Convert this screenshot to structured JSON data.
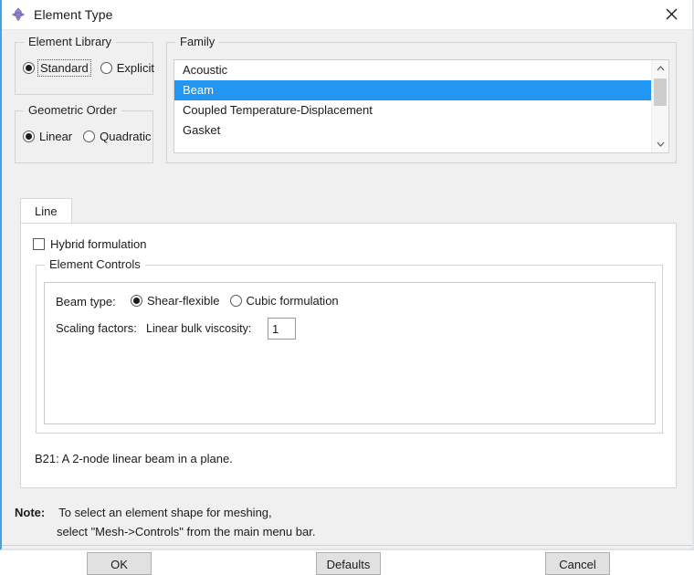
{
  "window": {
    "title": "Element Type",
    "icon": "abaqus-element-icon",
    "close_icon": "close-icon",
    "accent_color": "#4a9fe0"
  },
  "element_library": {
    "group_title": "Element Library",
    "options": [
      {
        "label": "Standard",
        "selected": true,
        "focused": true
      },
      {
        "label": "Explicit",
        "selected": false,
        "focused": false
      }
    ]
  },
  "geometric_order": {
    "group_title": "Geometric Order",
    "options": [
      {
        "label": "Linear",
        "selected": true
      },
      {
        "label": "Quadratic",
        "selected": false
      }
    ]
  },
  "family": {
    "group_title": "Family",
    "items": [
      {
        "label": "Acoustic",
        "selected": false
      },
      {
        "label": "Beam",
        "selected": true
      },
      {
        "label": "Coupled Temperature-Displacement",
        "selected": false
      },
      {
        "label": "Gasket",
        "selected": false
      }
    ],
    "selection_color": "#2196f3",
    "scrollbar": {
      "up_icon": "chevron-up-icon",
      "down_icon": "chevron-down-icon"
    }
  },
  "tabs": [
    {
      "label": "Line",
      "active": true
    }
  ],
  "panel": {
    "hybrid_formulation": {
      "label": "Hybrid formulation",
      "checked": false
    },
    "element_controls": {
      "group_title": "Element Controls",
      "beam_type": {
        "label": "Beam type:",
        "options": [
          {
            "label": "Shear-flexible",
            "selected": true
          },
          {
            "label": "Cubic formulation",
            "selected": false
          }
        ]
      },
      "scaling_factors": {
        "label": "Scaling factors:",
        "linear_bulk_viscosity": {
          "label": "Linear bulk viscosity:",
          "value": "1"
        }
      }
    },
    "description": "B21:  A 2-node linear beam in a plane."
  },
  "note": {
    "label": "Note:",
    "line1": "To select an element shape for meshing,",
    "line2": "select \"Mesh->Controls\" from the main menu bar."
  },
  "buttons": {
    "ok": "OK",
    "defaults": "Defaults",
    "cancel": "Cancel"
  }
}
